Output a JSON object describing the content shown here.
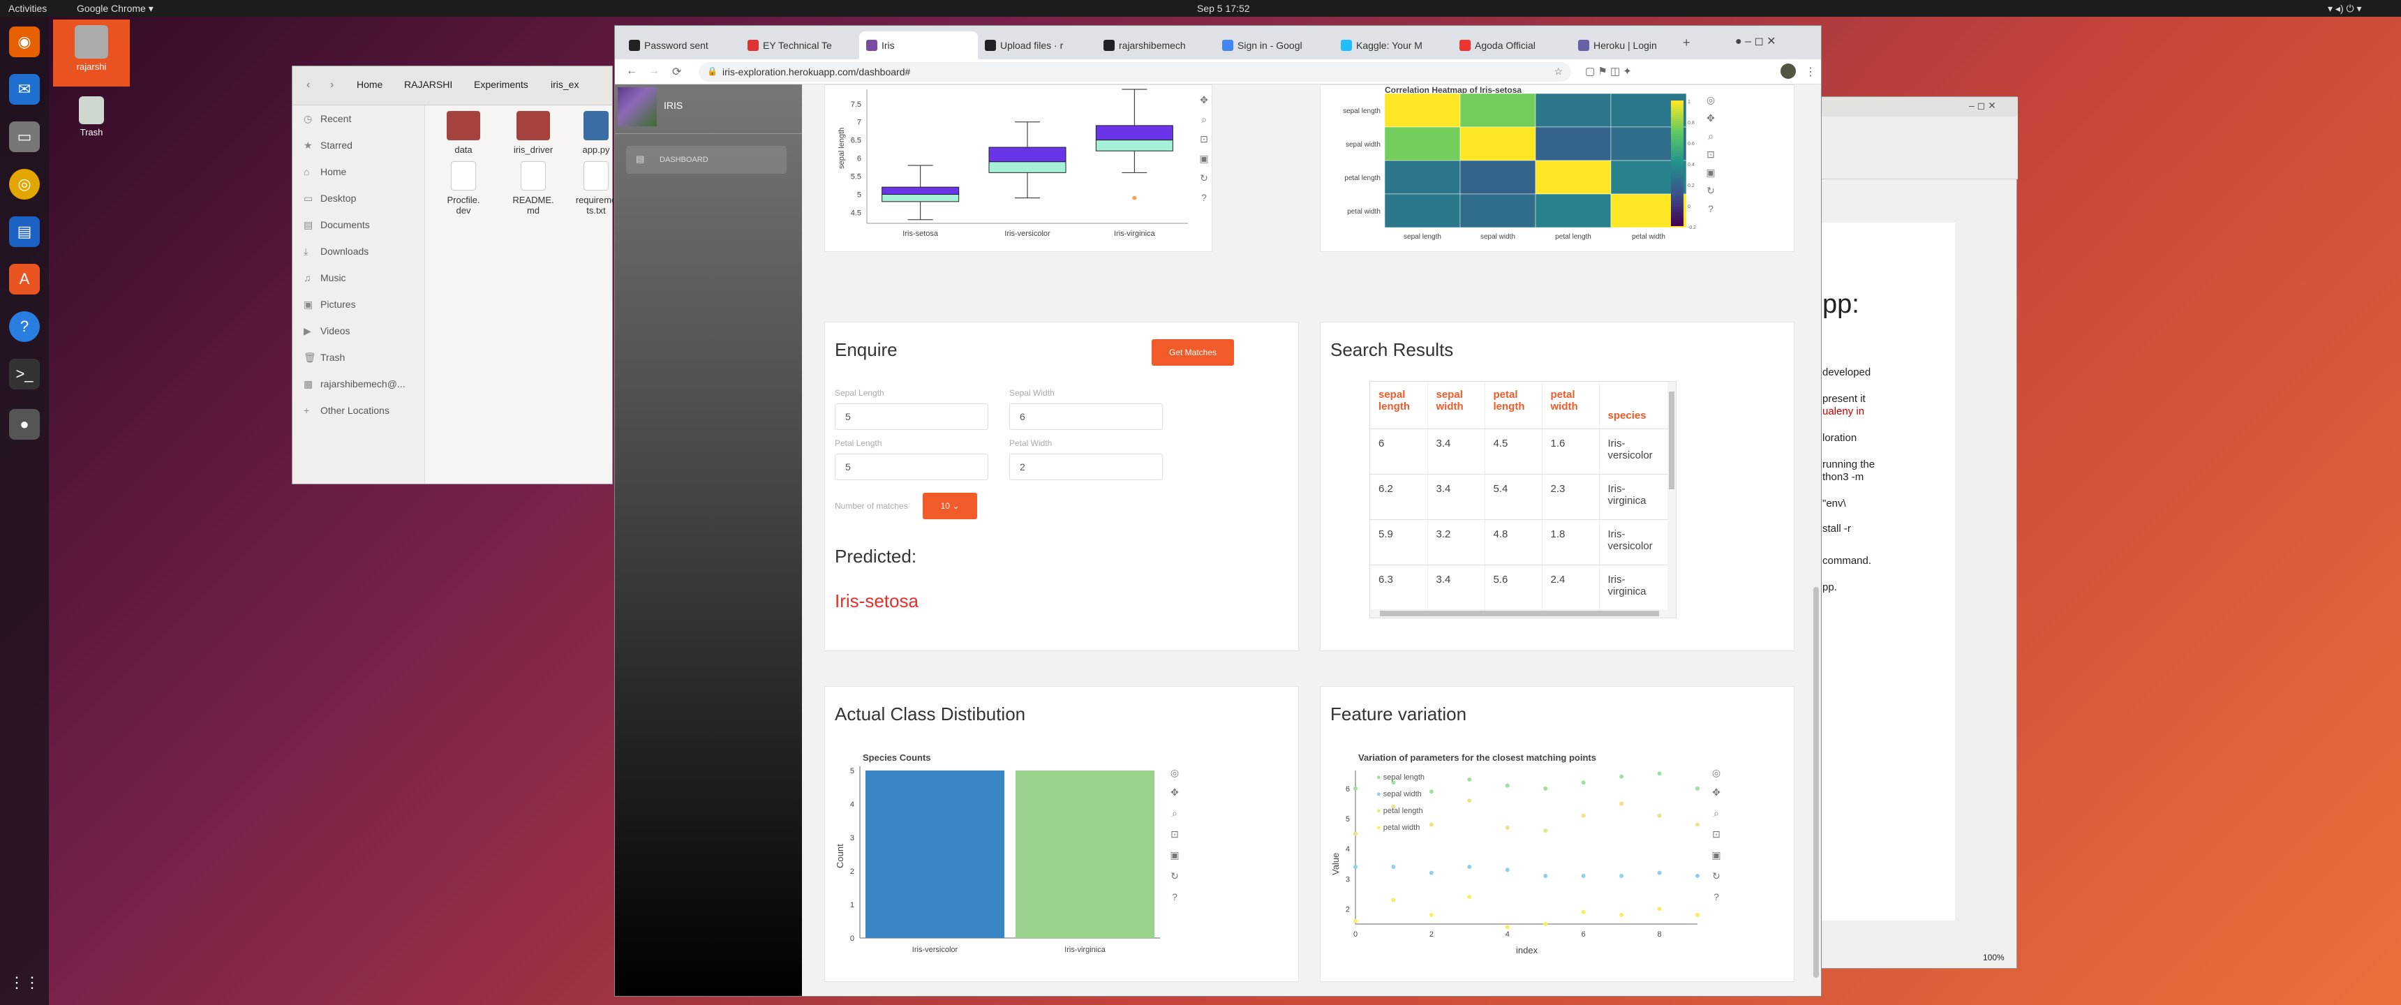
{
  "topbar": {
    "activities": "Activities",
    "app": "Google Chrome ▾",
    "clock": "Sep 5  17:52"
  },
  "desktop": {
    "home": "rajarshi",
    "trash": "Trash"
  },
  "files": {
    "path": [
      "Home",
      "RAJARSHI",
      "Experiments",
      "iris_ex"
    ],
    "side": [
      "Recent",
      "Starred",
      "Home",
      "Desktop",
      "Documents",
      "Downloads",
      "Music",
      "Pictures",
      "Videos",
      "Trash",
      "rajarshibemech@...",
      "Other Locations"
    ],
    "items": [
      "data",
      "iris_driver",
      "app.py",
      "Procfile.\ndev",
      "README.\nmd",
      "requireme\nts.txt"
    ]
  },
  "writer": {
    "lines": [
      "pp:",
      "developed",
      "present it",
      "ualeny in",
      "loration",
      "running the",
      "thon3 -m",
      "\"env\\",
      "stall -r",
      "command.",
      "pp."
    ],
    "zoom": "100%"
  },
  "chrome": {
    "tabs": [
      "Password sent",
      "EY Technical Te",
      "Iris",
      "Upload files · r",
      "rajarshibemech",
      "Sign in - Googl",
      "Kaggle: Your M",
      "Agoda Official",
      "Heroku | Login"
    ],
    "url": "iris-exploration.herokuapp.com/dashboard#"
  },
  "sidebar": {
    "title": "IRIS",
    "nav": "DASHBOARD"
  },
  "boxplot": {
    "ylabel": "sepal length",
    "yticks": [
      "7.5",
      "7",
      "6.5",
      "6",
      "5.5",
      "5",
      "4.5"
    ],
    "categories": [
      "Iris-setosa",
      "Iris-versicolor",
      "Iris-virginica"
    ]
  },
  "heatmap": {
    "title": "Correlation Heatmap of Iris-setosa",
    "labels": [
      "sepal length",
      "sepal width",
      "petal length",
      "petal width"
    ],
    "scale": [
      "1",
      "0.8",
      "0.6",
      "0.4",
      "0.2",
      "0",
      "-0.2"
    ]
  },
  "enquire": {
    "title": "Enquire",
    "button": "Get Matches",
    "sepal_length_label": "Sepal Length",
    "sepal_length": "5",
    "sepal_width_label": "Sepal Width",
    "sepal_width": "6",
    "petal_length_label": "Petal Length",
    "petal_length": "5",
    "petal_width_label": "Petal Width",
    "petal_width": "2",
    "matches_label": "Number of matches",
    "matches": "10",
    "predicted_label": "Predicted:",
    "predicted": "Iris-setosa"
  },
  "search": {
    "title": "Search Results",
    "headers": [
      "sepal\nlength",
      "sepal\nwidth",
      "petal\nlength",
      "petal\nwidth",
      "species"
    ],
    "rows": [
      [
        "6",
        "3.4",
        "4.5",
        "1.6",
        "Iris-\nversicolor"
      ],
      [
        "6.2",
        "3.4",
        "5.4",
        "2.3",
        "Iris-\nvirginica"
      ],
      [
        "5.9",
        "3.2",
        "4.8",
        "1.8",
        "Iris-\nversicolor"
      ],
      [
        "6.3",
        "3.4",
        "5.6",
        "2.4",
        "Iris-\nvirginica"
      ]
    ]
  },
  "actual": {
    "title": "Actual Class Distibution",
    "chart_title": "Species Counts",
    "ylabel": "Count",
    "yticks": [
      "5",
      "4",
      "3",
      "2",
      "1",
      "0"
    ]
  },
  "feature": {
    "title": "Feature variation",
    "chart_title": "Variation of parameters for the closest matching points",
    "xlabel": "index",
    "ylabel": "Value",
    "legend": [
      "sepal length",
      "sepal width",
      "petal length",
      "petal width"
    ]
  },
  "chart_data": [
    {
      "type": "box",
      "title": "",
      "ylabel": "sepal length",
      "categories": [
        "Iris-setosa",
        "Iris-versicolor",
        "Iris-virginica"
      ],
      "ylim": [
        4.2,
        7.9
      ],
      "boxes": [
        {
          "min": 4.3,
          "q1": 4.8,
          "median": 5.0,
          "q3": 5.2,
          "max": 5.8
        },
        {
          "min": 4.9,
          "q1": 5.6,
          "median": 5.9,
          "q3": 6.3,
          "max": 7.0
        },
        {
          "min": 5.6,
          "q1": 6.2,
          "median": 6.5,
          "q3": 6.9,
          "max": 7.9,
          "outliers": [
            4.9
          ]
        }
      ]
    },
    {
      "type": "heatmap",
      "title": "Correlation Heatmap of Iris-setosa",
      "x": [
        "sepal length",
        "sepal width",
        "petal length",
        "petal width"
      ],
      "y": [
        "sepal length",
        "sepal width",
        "petal length",
        "petal width"
      ],
      "values": [
        [
          1,
          0.74,
          0.27,
          0.28
        ],
        [
          0.74,
          1,
          0.18,
          0.23
        ],
        [
          0.27,
          0.18,
          1,
          0.33
        ],
        [
          0.28,
          0.23,
          0.33,
          1
        ]
      ],
      "range": [
        -0.2,
        1
      ]
    },
    {
      "type": "bar",
      "title": "Species Counts",
      "categories": [
        "Iris-versicolor",
        "Iris-virginica"
      ],
      "values": [
        5,
        5
      ],
      "ylabel": "Count",
      "ylim": [
        0,
        5
      ],
      "colors": [
        "#3a86c4",
        "#98d28c"
      ]
    },
    {
      "type": "scatter",
      "title": "Variation of parameters for the closest matching points",
      "xlabel": "index",
      "ylabel": "Value",
      "xlim": [
        0,
        9
      ],
      "ylim": [
        1.5,
        6.6
      ],
      "series": [
        {
          "name": "sepal length",
          "color": "#9ee0a0",
          "values": [
            6,
            6.2,
            5.9,
            6.3,
            6.1,
            6,
            6.2,
            6.4,
            6.5,
            6
          ]
        },
        {
          "name": "sepal width",
          "color": "#8fd0e8",
          "values": [
            3.4,
            3.4,
            3.2,
            3.4,
            3.3,
            3.1,
            3.1,
            3.1,
            3.2,
            3.1
          ]
        },
        {
          "name": "petal length",
          "color": "#e8e48a",
          "values": [
            4.5,
            5.4,
            4.8,
            5.6,
            4.7,
            4.6,
            5.1,
            5.5,
            5.1,
            4.8
          ]
        },
        {
          "name": "petal width",
          "color": "#f4f060",
          "values": [
            1.6,
            2.3,
            1.8,
            2.4,
            1.4,
            1.5,
            1.9,
            1.8,
            2.0,
            1.8
          ]
        }
      ]
    }
  ]
}
